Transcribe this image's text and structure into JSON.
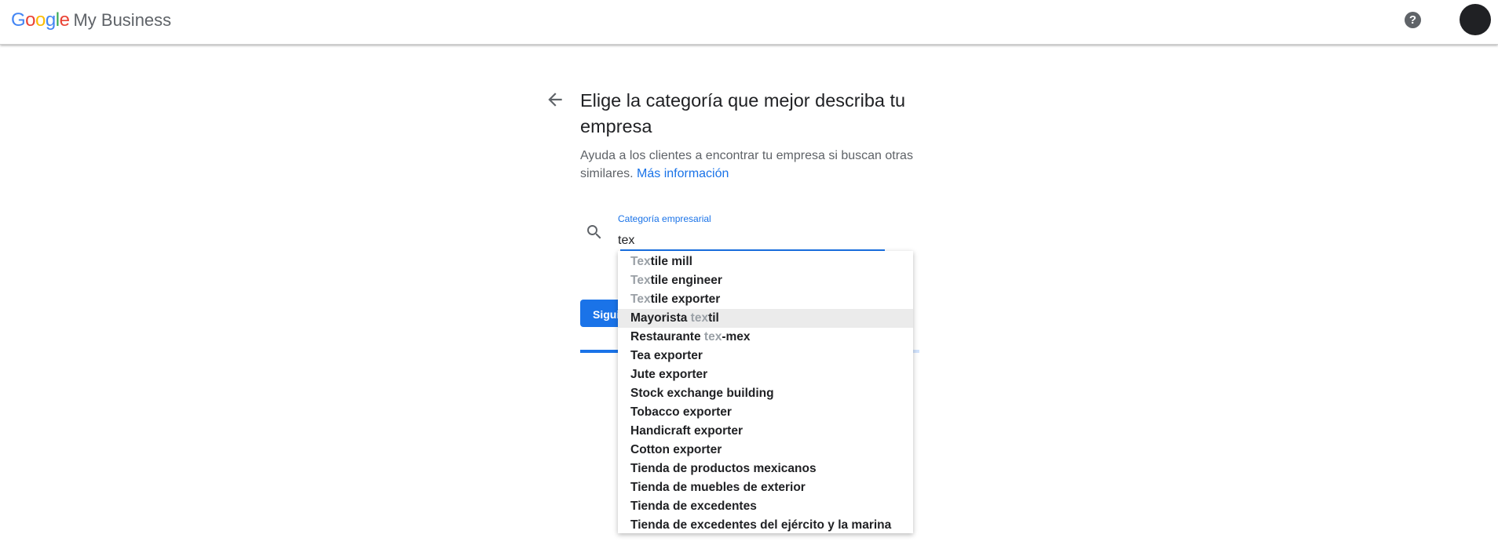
{
  "header": {
    "logo_letters": [
      {
        "ch": "G",
        "color": "#4285f4"
      },
      {
        "ch": "o",
        "color": "#ea4335"
      },
      {
        "ch": "o",
        "color": "#fbbc05"
      },
      {
        "ch": "g",
        "color": "#4285f4"
      },
      {
        "ch": "l",
        "color": "#34a853"
      },
      {
        "ch": "e",
        "color": "#ea4335"
      }
    ],
    "product_name": "My Business",
    "help_glyph": "?",
    "help_icon": "help-circle-icon",
    "avatar_color": "#202124"
  },
  "main": {
    "back_icon": "arrow-back-icon",
    "title": "Elige la categoría que mejor describa tu empresa",
    "subtitle": "Ayuda a los clientes a encontrar tu empresa si buscan otras similares.",
    "learn_more": "Más información",
    "field_label": "Categoría empresarial",
    "field_value": "tex",
    "next_label": "Siguiente",
    "progress": 0.23,
    "accent_color": "#1a73e8"
  },
  "suggestions": [
    {
      "text": "Textile mill",
      "match": [
        0,
        3
      ],
      "active": false
    },
    {
      "text": "Textile engineer",
      "match": [
        0,
        3
      ],
      "active": false
    },
    {
      "text": "Textile exporter",
      "match": [
        0,
        3
      ],
      "active": false
    },
    {
      "text": "Mayorista textil",
      "match": [
        10,
        13
      ],
      "active": true
    },
    {
      "text": "Restaurante tex-mex",
      "match": [
        12,
        15
      ],
      "active": false
    },
    {
      "text": "Tea exporter",
      "match": null,
      "active": false
    },
    {
      "text": "Jute exporter",
      "match": null,
      "active": false
    },
    {
      "text": "Stock exchange building",
      "match": null,
      "active": false
    },
    {
      "text": "Tobacco exporter",
      "match": null,
      "active": false
    },
    {
      "text": "Handicraft exporter",
      "match": null,
      "active": false
    },
    {
      "text": "Cotton exporter",
      "match": null,
      "active": false
    },
    {
      "text": "Tienda de productos mexicanos",
      "match": null,
      "active": false
    },
    {
      "text": "Tienda de muebles de exterior",
      "match": null,
      "active": false
    },
    {
      "text": "Tienda de excedentes",
      "match": null,
      "active": false
    },
    {
      "text": "Tienda de excedentes del ejército y la marina",
      "match": null,
      "active": false
    }
  ]
}
